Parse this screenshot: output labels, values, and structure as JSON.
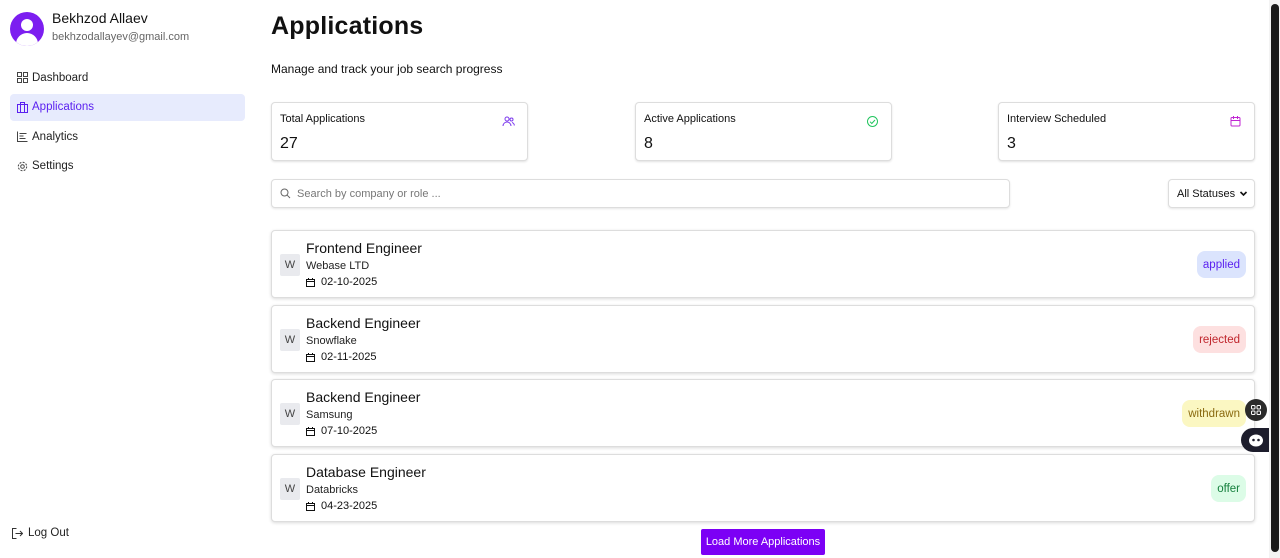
{
  "user": {
    "name": "Bekhzod Allaev",
    "email": "bekhzodallayev@gmail.com"
  },
  "sidebar": {
    "items": [
      {
        "label": "Dashboard",
        "icon": "dashboard-grid-icon",
        "active": false
      },
      {
        "label": "Applications",
        "icon": "briefcase-icon",
        "active": true
      },
      {
        "label": "Analytics",
        "icon": "chart-icon",
        "active": false
      },
      {
        "label": "Settings",
        "icon": "gear-icon",
        "active": false
      }
    ],
    "logout_label": "Log Out"
  },
  "header": {
    "title": "Applications",
    "subtitle": "Manage and track your job search progress"
  },
  "stats": [
    {
      "label": "Total Applications",
      "value": "27",
      "icon": "users-icon",
      "color": "#7c3aed"
    },
    {
      "label": "Active Applications",
      "value": "8",
      "icon": "check-circle-icon",
      "color": "#22c55e"
    },
    {
      "label": "Interview Scheduled",
      "value": "3",
      "icon": "calendar-icon",
      "color": "#c026d3"
    }
  ],
  "search": {
    "placeholder": "Search by company or role ..."
  },
  "filter": {
    "selected": "All Statuses"
  },
  "applications": [
    {
      "logo": "W",
      "title": "Frontend Engineer",
      "company": "Webase LTD",
      "date": "02-10-2025",
      "status": "applied",
      "status_bg": "#dbe4fd",
      "status_fg": "#5b21f0"
    },
    {
      "logo": "W",
      "title": "Backend Engineer",
      "company": "Snowflake",
      "date": "02-11-2025",
      "status": "rejected",
      "status_bg": "#fde0e0",
      "status_fg": "#c0262d"
    },
    {
      "logo": "W",
      "title": "Backend Engineer",
      "company": "Samsung",
      "date": "07-10-2025",
      "status": "withdrawn",
      "status_bg": "#fbf7c2",
      "status_fg": "#8a6a10"
    },
    {
      "logo": "W",
      "title": "Database Engineer",
      "company": "Databricks",
      "date": "04-23-2025",
      "status": "offer",
      "status_bg": "#dcfce7",
      "status_fg": "#15803d"
    }
  ],
  "load_more_label": "Load More Applications",
  "theme": {
    "accent": "#7c00f5"
  }
}
